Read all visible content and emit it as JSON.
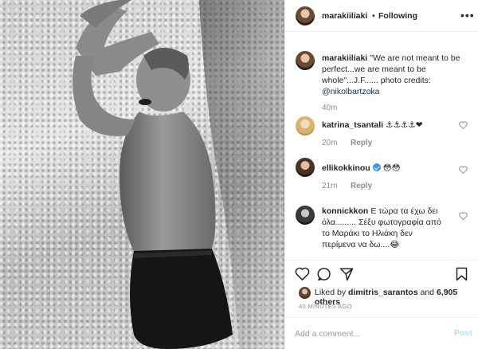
{
  "header": {
    "username": "marakiiliaki",
    "separator": "•",
    "follow_status": "Following",
    "more_icon": "more-horizontal-icon"
  },
  "caption": {
    "username": "marakiiliaki",
    "text": "\"We are not meant to be perfect...we are meant to be whole\"...J.F...... photo credits: @nikolbartzoka",
    "line1": "\"We are not meant to be",
    "line2": "perfect...we are meant to be",
    "line3": "whole\"...J.F...... photo credits:",
    "mention": "@nikolbartzoka",
    "time": "40m"
  },
  "comments": [
    {
      "username": "katrina_tsantali",
      "text": "⚓⚓⚓⚓❤",
      "time": "20m",
      "reply": "Reply",
      "verified": false
    },
    {
      "username": "ellikokkinou",
      "text": "😳😳",
      "time": "21m",
      "reply": "Reply",
      "verified": true
    },
    {
      "username": "konnickkon",
      "line1": "Ε τώρα τα έχω δει",
      "line2": "όλα......... Σέξυ φωτογραφία από",
      "line3": "το Μαράκι το Ηλιάκη δεν",
      "line4": "περίμενα να δω....😂",
      "verified": false
    }
  ],
  "actions": {
    "icons": [
      "heart-icon",
      "comment-icon",
      "share-icon",
      "bookmark-icon"
    ]
  },
  "likes": {
    "prefix": "Liked by ",
    "user": "dimitris_sarantos",
    "middle": " and ",
    "count": "6,905 others"
  },
  "time_ago": "40 MINUTES AGO",
  "add_comment": {
    "placeholder": "Add a comment...",
    "post_label": "Post"
  },
  "colors": {
    "link": "#003569",
    "verified": "#3897f0",
    "post_disabled": "#b2dffc",
    "muted": "#8e8e8e"
  }
}
